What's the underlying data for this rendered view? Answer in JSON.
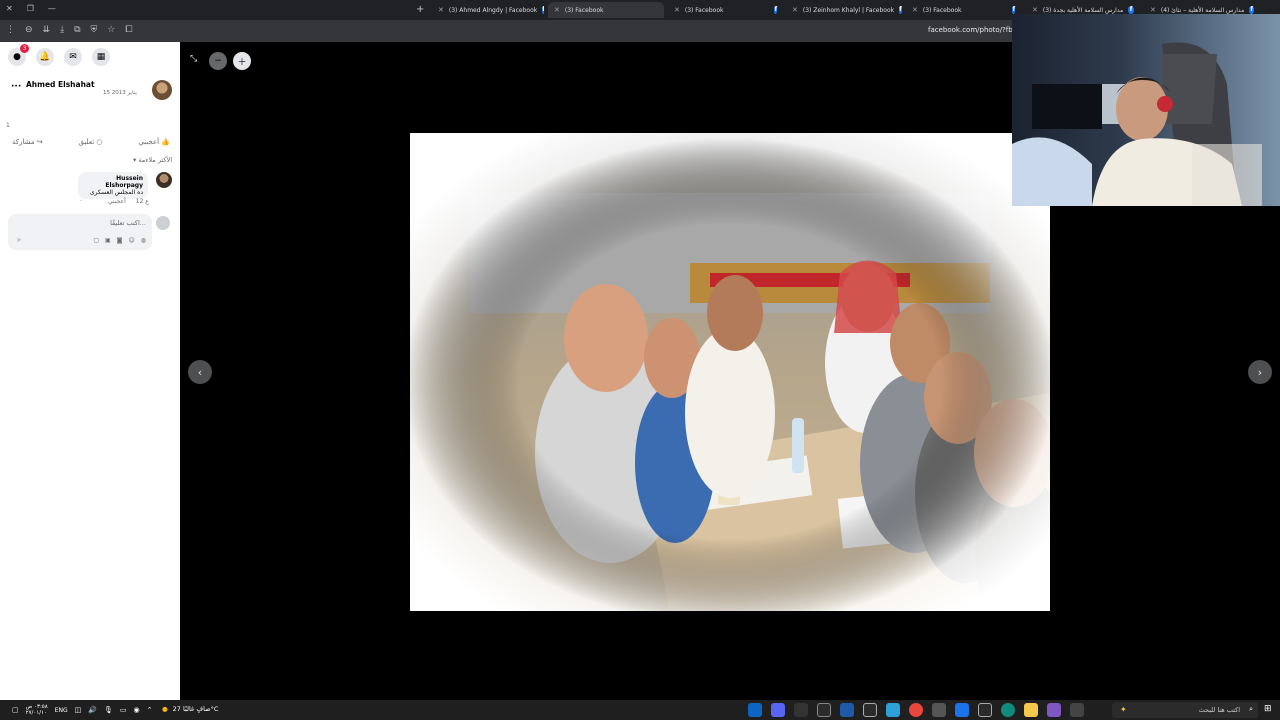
{
  "browser": {
    "tabs": [
      {
        "title": "(3) Ahmed Alngdy | Facebook",
        "active": false
      },
      {
        "title": "(3) Facebook",
        "active": true
      },
      {
        "title": "(3) Facebook",
        "active": false
      },
      {
        "title": "(3) Zeinhom Khalyl | Facebook",
        "active": false
      },
      {
        "title": "(3) Facebook",
        "active": false
      },
      {
        "title": "(3) مدارس السلامة الأهلية بجدة",
        "active": false
      },
      {
        "title": "(4) مدارس السلامة الأهلية – نثائ",
        "active": false
      }
    ],
    "new_tab": "+",
    "url": "facebook.com/photo/?fbid"
  },
  "panel": {
    "notification_count": "3",
    "poster_name": "Ahmed Elshahat",
    "post_date": "15 يناير 2013",
    "reaction_count": "1",
    "actions": {
      "like": "أعجبني",
      "comment": "تعليق",
      "share": "مشاركة"
    },
    "sort_label": "الأكثر ملاءمة",
    "comment": {
      "author": "Hussein Elshorpagy",
      "text": "ده المجلس العسكرى",
      "age": "12 ع",
      "like": "أعجبني"
    },
    "compose_placeholder": "اكتب تعليقًا..."
  },
  "taskbar": {
    "time": "٠٣:٥٨ ص",
    "date": "٢٧/٠١/١٠",
    "lang": "ENG",
    "weather": "صافٍ غالبًا  27°C",
    "search_placeholder": "اكتب هنا للبحث"
  },
  "colors": {
    "facebook_blue": "#1877f2",
    "notification_red": "#e41e3f",
    "viewer_bg": "#000000"
  }
}
